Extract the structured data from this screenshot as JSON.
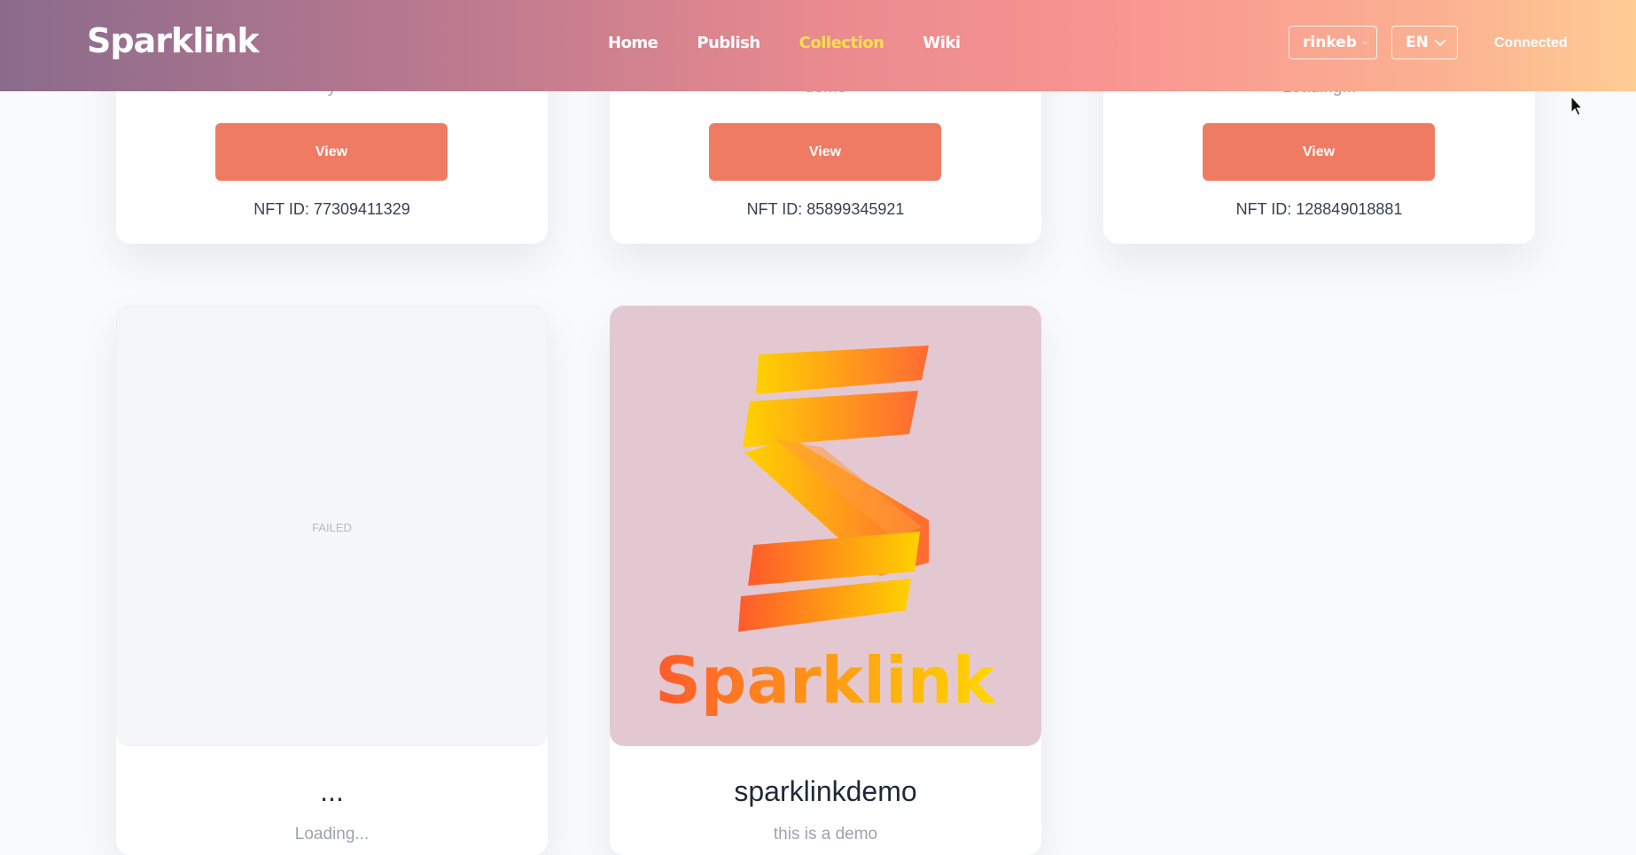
{
  "header": {
    "brand": "Sparklink",
    "nav": [
      {
        "label": "Home",
        "active": false
      },
      {
        "label": "Publish",
        "active": false
      },
      {
        "label": "Collection",
        "active": true
      },
      {
        "label": "Wiki",
        "active": false
      }
    ],
    "network_select": "rinkeb",
    "language_select": "EN",
    "status": "Connected"
  },
  "cards_top": [
    {
      "desc": "y",
      "button": "View",
      "nft_id": "NFT ID: 77309411329"
    },
    {
      "desc": "demo",
      "button": "View",
      "nft_id": "NFT ID: 85899345921"
    },
    {
      "desc": "Loading...",
      "button": "View",
      "nft_id": "NFT ID: 128849018881"
    }
  ],
  "cards_bottom": [
    {
      "image_status": "FAILED",
      "title": "...",
      "desc": "Loading..."
    },
    {
      "image_text": "Sparklink",
      "title": "sparklinkdemo",
      "desc": "this is a demo"
    }
  ],
  "colors": {
    "accent": "#f07b63",
    "nav_active": "#f7e04a"
  }
}
